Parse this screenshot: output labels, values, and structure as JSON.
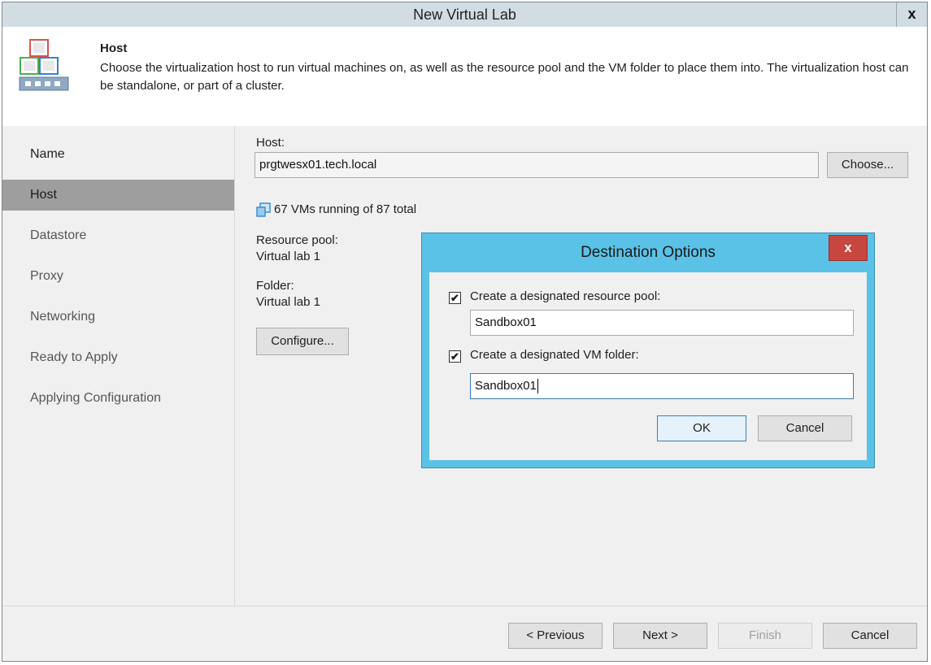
{
  "window": {
    "title": "New Virtual Lab",
    "close_glyph": "x"
  },
  "header": {
    "title": "Host",
    "description": "Choose the virtualization host to run virtual machines on, as well as the resource pool and the VM folder to place them into. The virtualization host can be standalone, or part of a cluster.",
    "icon": "host-icon"
  },
  "sidebar": {
    "steps": [
      {
        "label": "Name"
      },
      {
        "label": "Host"
      },
      {
        "label": "Datastore"
      },
      {
        "label": "Proxy"
      },
      {
        "label": "Networking"
      },
      {
        "label": "Ready to Apply"
      },
      {
        "label": "Applying Configuration"
      }
    ],
    "active_index": 1
  },
  "main": {
    "host_label": "Host:",
    "host_value": "prgtwesx01.tech.local",
    "choose_button": "Choose...",
    "vms_status": "67 VMs running of 87 total",
    "resource_pool_label": "Resource pool:",
    "resource_pool_value": "Virtual lab 1",
    "folder_label": "Folder:",
    "folder_value": "Virtual lab 1",
    "configure_button": "Configure..."
  },
  "dialog": {
    "title": "Destination Options",
    "close_glyph": "x",
    "pool_checkbox_label": "Create a designated resource pool:",
    "pool_checked": true,
    "pool_value": "Sandbox01",
    "folder_checkbox_label": "Create a designated VM folder:",
    "folder_checked": true,
    "folder_value": "Sandbox01",
    "ok_button": "OK",
    "cancel_button": "Cancel",
    "check_glyph": "✔"
  },
  "footer": {
    "previous_button": "< Previous",
    "next_button": "Next >",
    "finish_button": "Finish",
    "cancel_button": "Cancel"
  },
  "colors": {
    "titlebar": "#d2dde3",
    "active_step": "#9e9e9e",
    "dialog_frame": "#5ac2e6",
    "dialog_close": "#c7463f"
  }
}
